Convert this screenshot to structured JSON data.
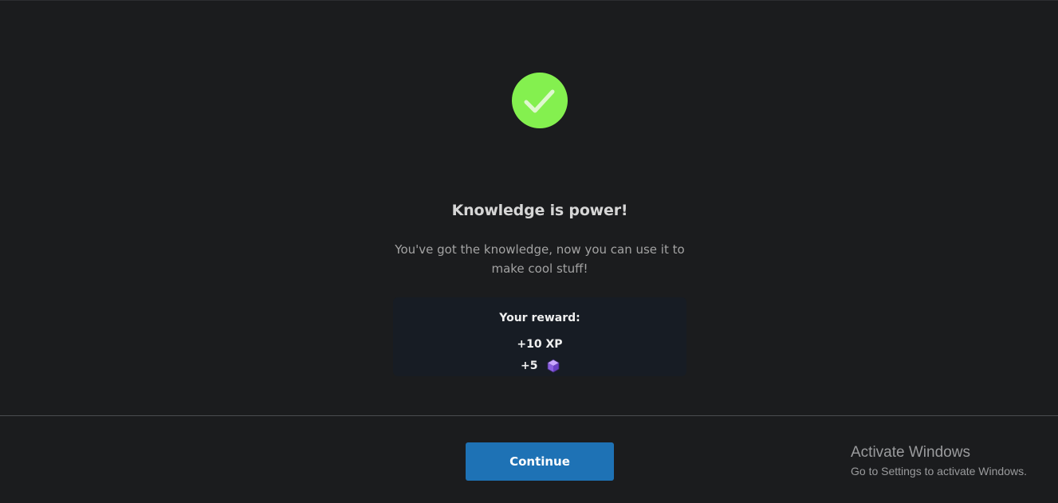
{
  "result": {
    "title": "Knowledge is power!",
    "subtitle": "You've got the knowledge, now you can use it to make cool stuff!"
  },
  "reward": {
    "heading": "Your reward:",
    "xp": "+10 XP",
    "gems": "+5",
    "gem_icon": "purple-cube-icon"
  },
  "footer": {
    "continue_label": "Continue"
  },
  "watermark": {
    "title": "Activate Windows",
    "subtitle": "Go to Settings to activate Windows."
  },
  "colors": {
    "background": "#1b1c1e",
    "success": "#84f04f",
    "button": "#1e72b5",
    "reward_box": "#171c24"
  }
}
